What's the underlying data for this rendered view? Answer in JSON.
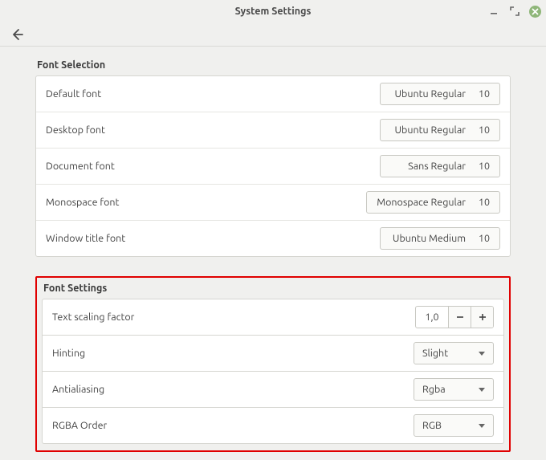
{
  "window": {
    "title": "System Settings"
  },
  "sections": {
    "font_selection": {
      "title": "Font Selection",
      "rows": {
        "default": {
          "label": "Default font",
          "font": "Ubuntu Regular",
          "size": "10"
        },
        "desktop": {
          "label": "Desktop font",
          "font": "Ubuntu Regular",
          "size": "10"
        },
        "document": {
          "label": "Document font",
          "font": "Sans Regular",
          "size": "10"
        },
        "monospace": {
          "label": "Monospace font",
          "font": "Monospace Regular",
          "size": "10"
        },
        "wintitle": {
          "label": "Window title font",
          "font": "Ubuntu Medium",
          "size": "10"
        }
      }
    },
    "font_settings": {
      "title": "Font Settings",
      "text_scaling": {
        "label": "Text scaling factor",
        "value": "1,0"
      },
      "hinting": {
        "label": "Hinting",
        "value": "Slight"
      },
      "antialiasing": {
        "label": "Antialiasing",
        "value": "Rgba"
      },
      "rgba_order": {
        "label": "RGBA Order",
        "value": "RGB"
      }
    }
  }
}
